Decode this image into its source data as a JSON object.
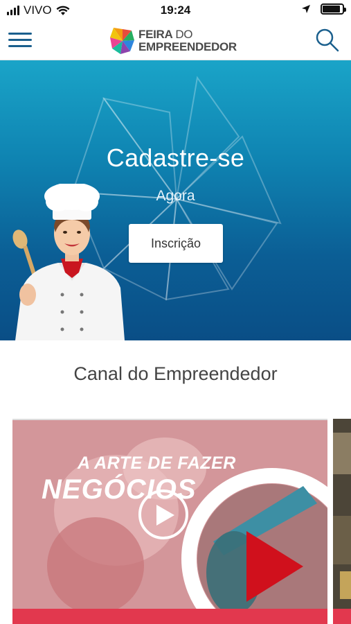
{
  "status_bar": {
    "carrier": "VIVO",
    "time": "19:24"
  },
  "header": {
    "logo_line1_a": "FEIRA",
    "logo_line1_b": "DO",
    "logo_line2": "EMPREENDEDOR",
    "menu_icon": "hamburger-menu-icon",
    "search_icon": "search-icon"
  },
  "hero": {
    "title": "Cadastre-se",
    "subtitle": "Agora",
    "button_label": "Inscrição"
  },
  "section": {
    "title": "Canal do Empreendedor"
  },
  "videos": [
    {
      "headline_1": "A ARTE DE FAZER",
      "headline_2": "NEGÓCIOS"
    }
  ],
  "colors": {
    "brand_blue": "#1a5f8d",
    "hero_top": "#1aa4c8",
    "hero_bottom": "#0a4e86",
    "video_red": "#e2384e",
    "play_red": "#d0101c"
  }
}
